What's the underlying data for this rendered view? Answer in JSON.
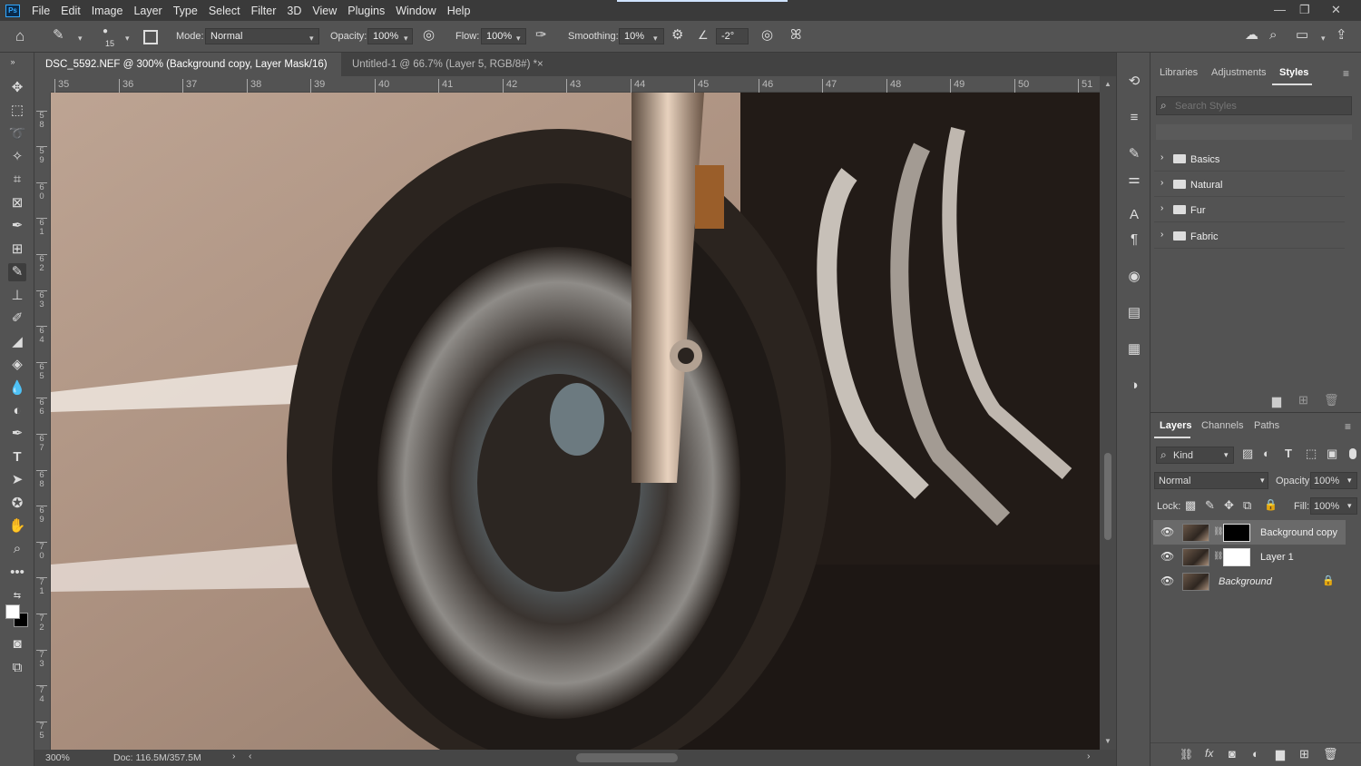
{
  "app": {
    "logo": "Ps"
  },
  "menu": [
    "File",
    "Edit",
    "Image",
    "Layer",
    "Type",
    "Select",
    "Filter",
    "3D",
    "View",
    "Plugins",
    "Window",
    "Help"
  ],
  "window_controls": {
    "minimize": "—",
    "restore": "❐",
    "close": "✕"
  },
  "options": {
    "brush_size": "15",
    "mode_label": "Mode:",
    "mode_value": "Normal",
    "opacity_label": "Opacity:",
    "opacity_value": "100%",
    "flow_label": "Flow:",
    "flow_value": "100%",
    "smoothing_label": "Smoothing:",
    "smoothing_value": "10%",
    "angle_value": "-2°"
  },
  "tabs": [
    {
      "label": "DSC_5592.NEF @ 300% (Background copy, Layer Mask/16) *",
      "close": "×"
    },
    {
      "label": "Untitled-1 @ 66.7% (Layer 5, RGB/8#) *",
      "close": "×"
    }
  ],
  "ruler_h": [
    "35",
    "36",
    "37",
    "38",
    "39",
    "40",
    "41",
    "42",
    "43",
    "44",
    "45",
    "46",
    "47",
    "48",
    "49",
    "50",
    "51"
  ],
  "ruler_v": [
    "5\n8",
    "5\n9",
    "6\n0",
    "6\n1",
    "6\n2",
    "6\n3",
    "6\n4",
    "6\n5",
    "6\n6",
    "6\n7",
    "6\n8",
    "6\n9",
    "7\n0",
    "7\n1",
    "7\n2",
    "7\n3",
    "7\n4",
    "7\n5"
  ],
  "status": {
    "zoom": "300%",
    "doc": "Doc: 116.5M/357.5M",
    "arrow": "›",
    "left_arrow": "‹"
  },
  "styles_panel": {
    "tabs": [
      "Libraries",
      "Adjustments",
      "Styles"
    ],
    "active_tab": "Styles",
    "search_placeholder": "Search Styles",
    "groups": [
      "Basics",
      "Natural",
      "Fur",
      "Fabric"
    ]
  },
  "layers_panel": {
    "tabs": [
      "Layers",
      "Channels",
      "Paths"
    ],
    "active_tab": "Layers",
    "kind_label": "Kind",
    "blend_mode": "Normal",
    "opacity_label": "Opacity:",
    "opacity_value": "100%",
    "lock_label": "Lock:",
    "fill_label": "Fill:",
    "fill_value": "100%",
    "layers": [
      {
        "name": "Background copy",
        "selected": true
      },
      {
        "name": "Layer 1",
        "selected": false
      },
      {
        "name": "Background",
        "selected": false
      }
    ]
  }
}
